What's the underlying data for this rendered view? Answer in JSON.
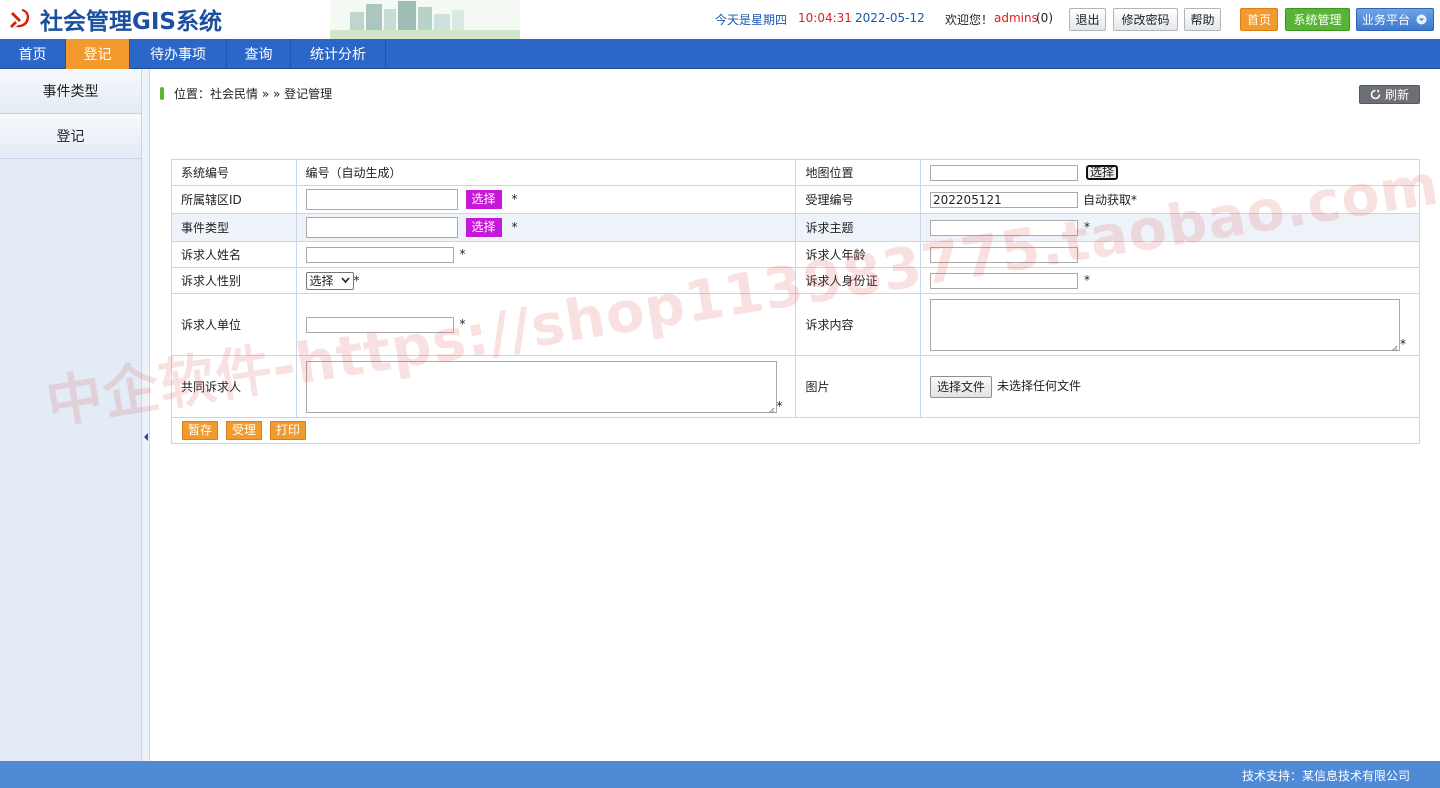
{
  "app": {
    "title": "社会管理GIS系统"
  },
  "topinfo": {
    "weekday": "今天是星期四",
    "time": "10:04:31",
    "date": "2022-05-12",
    "welcome": "欢迎您！",
    "user": "admins",
    "count": "(0)"
  },
  "top_buttons": {
    "logout": "退出",
    "change_password": "修改密码",
    "help": "帮助",
    "home": "首页",
    "system_admin": "系统管理",
    "platform": "业务平台"
  },
  "nav": [
    "首页",
    "登记",
    "待办事项",
    "查询",
    "统计分析"
  ],
  "sidebar": [
    "事件类型",
    "登记"
  ],
  "breadcrumb": {
    "prefix": "位置：",
    "path": "社会民情 » » 登记管理"
  },
  "refresh_label": "刷新",
  "form": {
    "system_no_label": "系统编号",
    "system_no_value": "编号（自动生成）",
    "map_label": "地图位置",
    "map_pick": "选择",
    "district_label": "所属辖区ID",
    "district_pick": "选择",
    "accept_no_label": "受理编号",
    "accept_no_value": "202205121",
    "accept_no_hint": "自动获取*",
    "event_type_label": "事件类型",
    "event_type_pick": "选择",
    "subject_label": "诉求主题",
    "name_label": "诉求人姓名",
    "age_label": "诉求人年龄",
    "gender_label": "诉求人性别",
    "gender_select": "选择",
    "idcard_label": "诉求人身份证",
    "unit_label": "诉求人单位",
    "content_label": "诉求内容",
    "co_label": "共同诉求人",
    "image_label": "图片",
    "file_button": "选择文件",
    "file_status": "未选择任何文件",
    "required_mark": "*"
  },
  "actions": [
    "暂存",
    "受理",
    "打印"
  ],
  "footer": "技术支持：某信息技术有限公司",
  "watermark": "中企软件-https://shop113983775.taobao.com",
  "colors": {
    "nav_blue": "#2a67c9",
    "active_orange": "#f29a2e",
    "pick_purple": "#c519d7",
    "green": "#58b434",
    "red_text": "#e02020"
  }
}
